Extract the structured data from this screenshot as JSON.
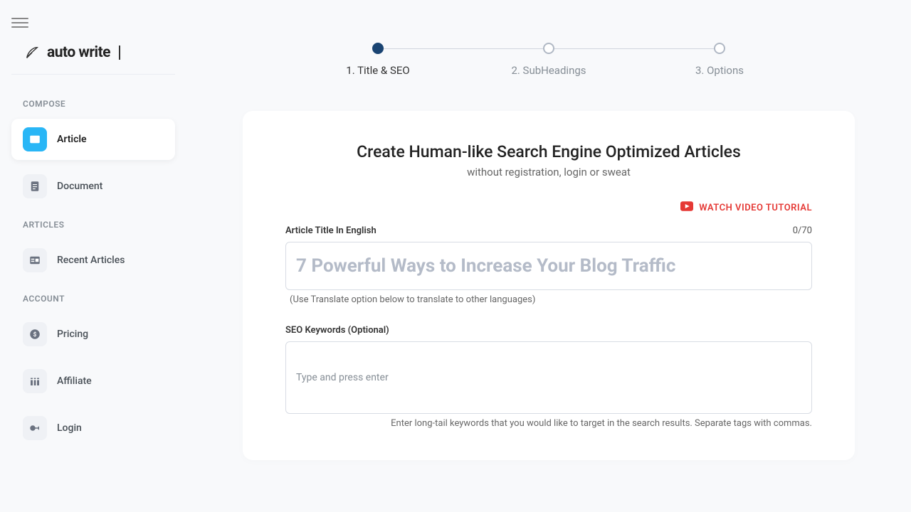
{
  "brand": {
    "name": "auto write"
  },
  "sidebar": {
    "sections": {
      "compose": "COMPOSE",
      "articles": "ARTICLES",
      "account": "ACCOUNT"
    },
    "items": {
      "article": "Article",
      "document": "Document",
      "recent": "Recent Articles",
      "pricing": "Pricing",
      "affiliate": "Affiliate",
      "login": "Login"
    }
  },
  "stepper": {
    "step1": "1. Title & SEO",
    "step2": "2. SubHeadings",
    "step3": "3. Options"
  },
  "main": {
    "heading": "Create Human-like Search Engine Optimized Articles",
    "subheading": "without registration, login or sweat",
    "video_link": "WATCH VIDEO TUTORIAL",
    "title_label": "Article Title In English",
    "title_count": "0/70",
    "title_placeholder": "7 Powerful Ways to Increase Your Blog Traffic",
    "title_hint": "(Use Translate option below to translate to other languages)",
    "keywords_label": "SEO Keywords (Optional)",
    "keywords_placeholder": "Type and press enter",
    "keywords_hint": "Enter long-tail keywords that you would like to target in the search results. Separate tags with commas."
  }
}
